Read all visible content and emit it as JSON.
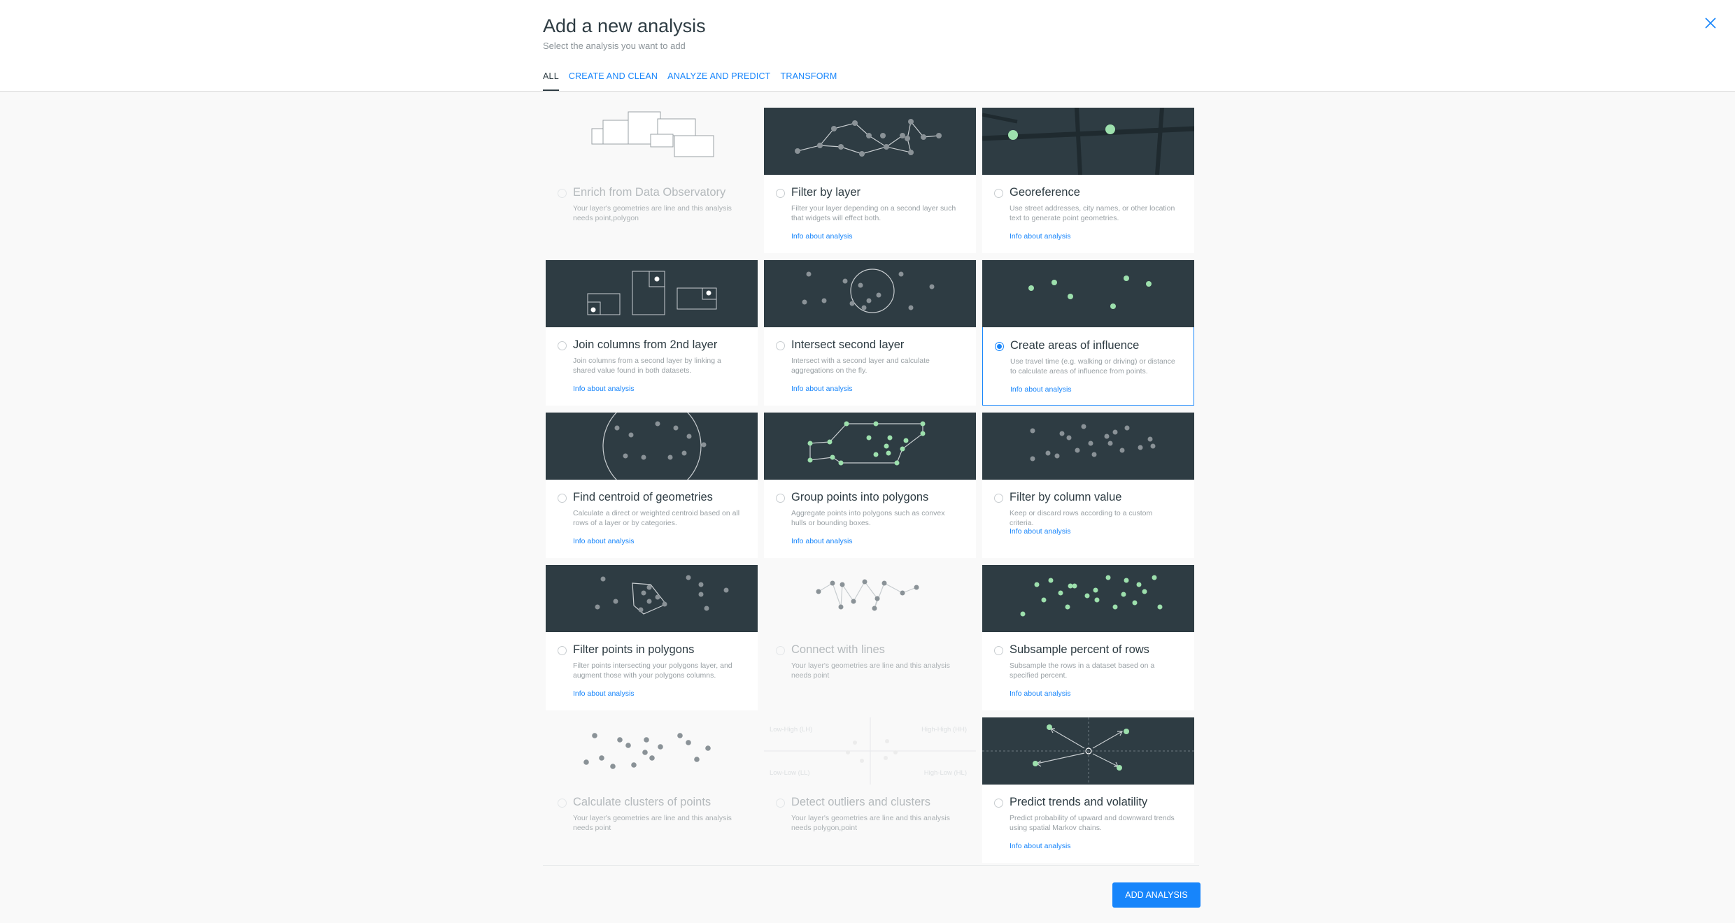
{
  "header": {
    "title": "Add a new analysis",
    "subtitle": "Select the analysis you want to add"
  },
  "tabs": [
    {
      "label": "ALL",
      "active": true
    },
    {
      "label": "CREATE AND CLEAN",
      "active": false
    },
    {
      "label": "ANALYZE AND PREDICT",
      "active": false
    },
    {
      "label": "TRANSFORM",
      "active": false
    }
  ],
  "cards": [
    {
      "title": "Enrich from Data Observatory",
      "desc": "Your layer's geometries are line and this analysis needs point,polygon",
      "info": "",
      "state": "disabled",
      "icon": "enrich-illustration"
    },
    {
      "title": "Filter by layer",
      "desc": "Filter your layer depending on a second layer such that widgets will effect both.",
      "info": "Info about analysis",
      "state": "enabled",
      "icon": "filter-by-layer-illustration"
    },
    {
      "title": "Georeference",
      "desc": "Use street addresses, city names, or other location text to generate point geometries.",
      "info": "Info about analysis",
      "state": "enabled",
      "icon": "georeference-illustration"
    },
    {
      "title": "Join columns from 2nd layer",
      "desc": "Join columns from a second layer by linking a shared value found in both datasets.",
      "info": "Info about analysis",
      "state": "enabled",
      "icon": "join-columns-illustration"
    },
    {
      "title": "Intersect second layer",
      "desc": "Intersect with a second layer and calculate aggregations on the fly.",
      "info": "Info about analysis",
      "state": "enabled",
      "icon": "intersect-illustration"
    },
    {
      "title": "Create areas of influence",
      "desc": "Use travel time (e.g. walking or driving) or distance to calculate areas of influence from points.",
      "info": "Info about analysis",
      "state": "selected",
      "icon": "areas-of-influence-illustration"
    },
    {
      "title": "Find centroid of geometries",
      "desc": "Calculate a direct or weighted centroid based on all rows of a layer or by categories.",
      "info": "Info about analysis",
      "state": "enabled",
      "icon": "centroid-illustration"
    },
    {
      "title": "Group points into polygons",
      "desc": "Aggregate points into polygons such as convex hulls or bounding boxes.",
      "info": "Info about analysis",
      "state": "enabled",
      "icon": "group-points-illustration"
    },
    {
      "title": "Filter by column value",
      "desc": "Keep or discard rows according to a custom criteria.",
      "info": "Info about analysis",
      "state": "enabled",
      "icon": "filter-column-illustration"
    },
    {
      "title": "Filter points in polygons",
      "desc": "Filter points intersecting your polygons layer, and augment those with your polygons columns.",
      "info": "Info about analysis",
      "state": "enabled",
      "icon": "filter-points-polygons-illustration"
    },
    {
      "title": "Connect with lines",
      "desc": "Your layer's geometries are line and this analysis needs point",
      "info": "",
      "state": "disabled",
      "icon": "connect-lines-illustration"
    },
    {
      "title": "Subsample percent of rows",
      "desc": "Subsample the rows in a dataset based on a specified percent.",
      "info": "Info about analysis",
      "state": "enabled",
      "icon": "subsample-illustration"
    },
    {
      "title": "Calculate clusters of points",
      "desc": "Your layer's geometries are line and this analysis needs point",
      "info": "",
      "state": "disabled",
      "icon": "clusters-illustration"
    },
    {
      "title": "Detect outliers and clusters",
      "desc": "Your layer's geometries are line and this analysis needs polygon,point",
      "info": "",
      "state": "disabled",
      "icon": "outliers-illustration"
    },
    {
      "title": "Predict trends and volatility",
      "desc": "Predict probability of upward and downward trends using spatial Markov chains.",
      "info": "Info about analysis",
      "state": "enabled",
      "icon": "predict-trends-illustration"
    }
  ],
  "outliers_labels": {
    "lh": "Low-High (LH)",
    "hh": "High-High (HH)",
    "ll": "Low-Low (LL)",
    "hl": "High-Low (HL)"
  },
  "footer": {
    "add_label": "ADD ANALYSIS"
  },
  "colors": {
    "accent": "#1785fb",
    "thumb_bg": "#2e3c43",
    "green": "#9de0ad"
  }
}
